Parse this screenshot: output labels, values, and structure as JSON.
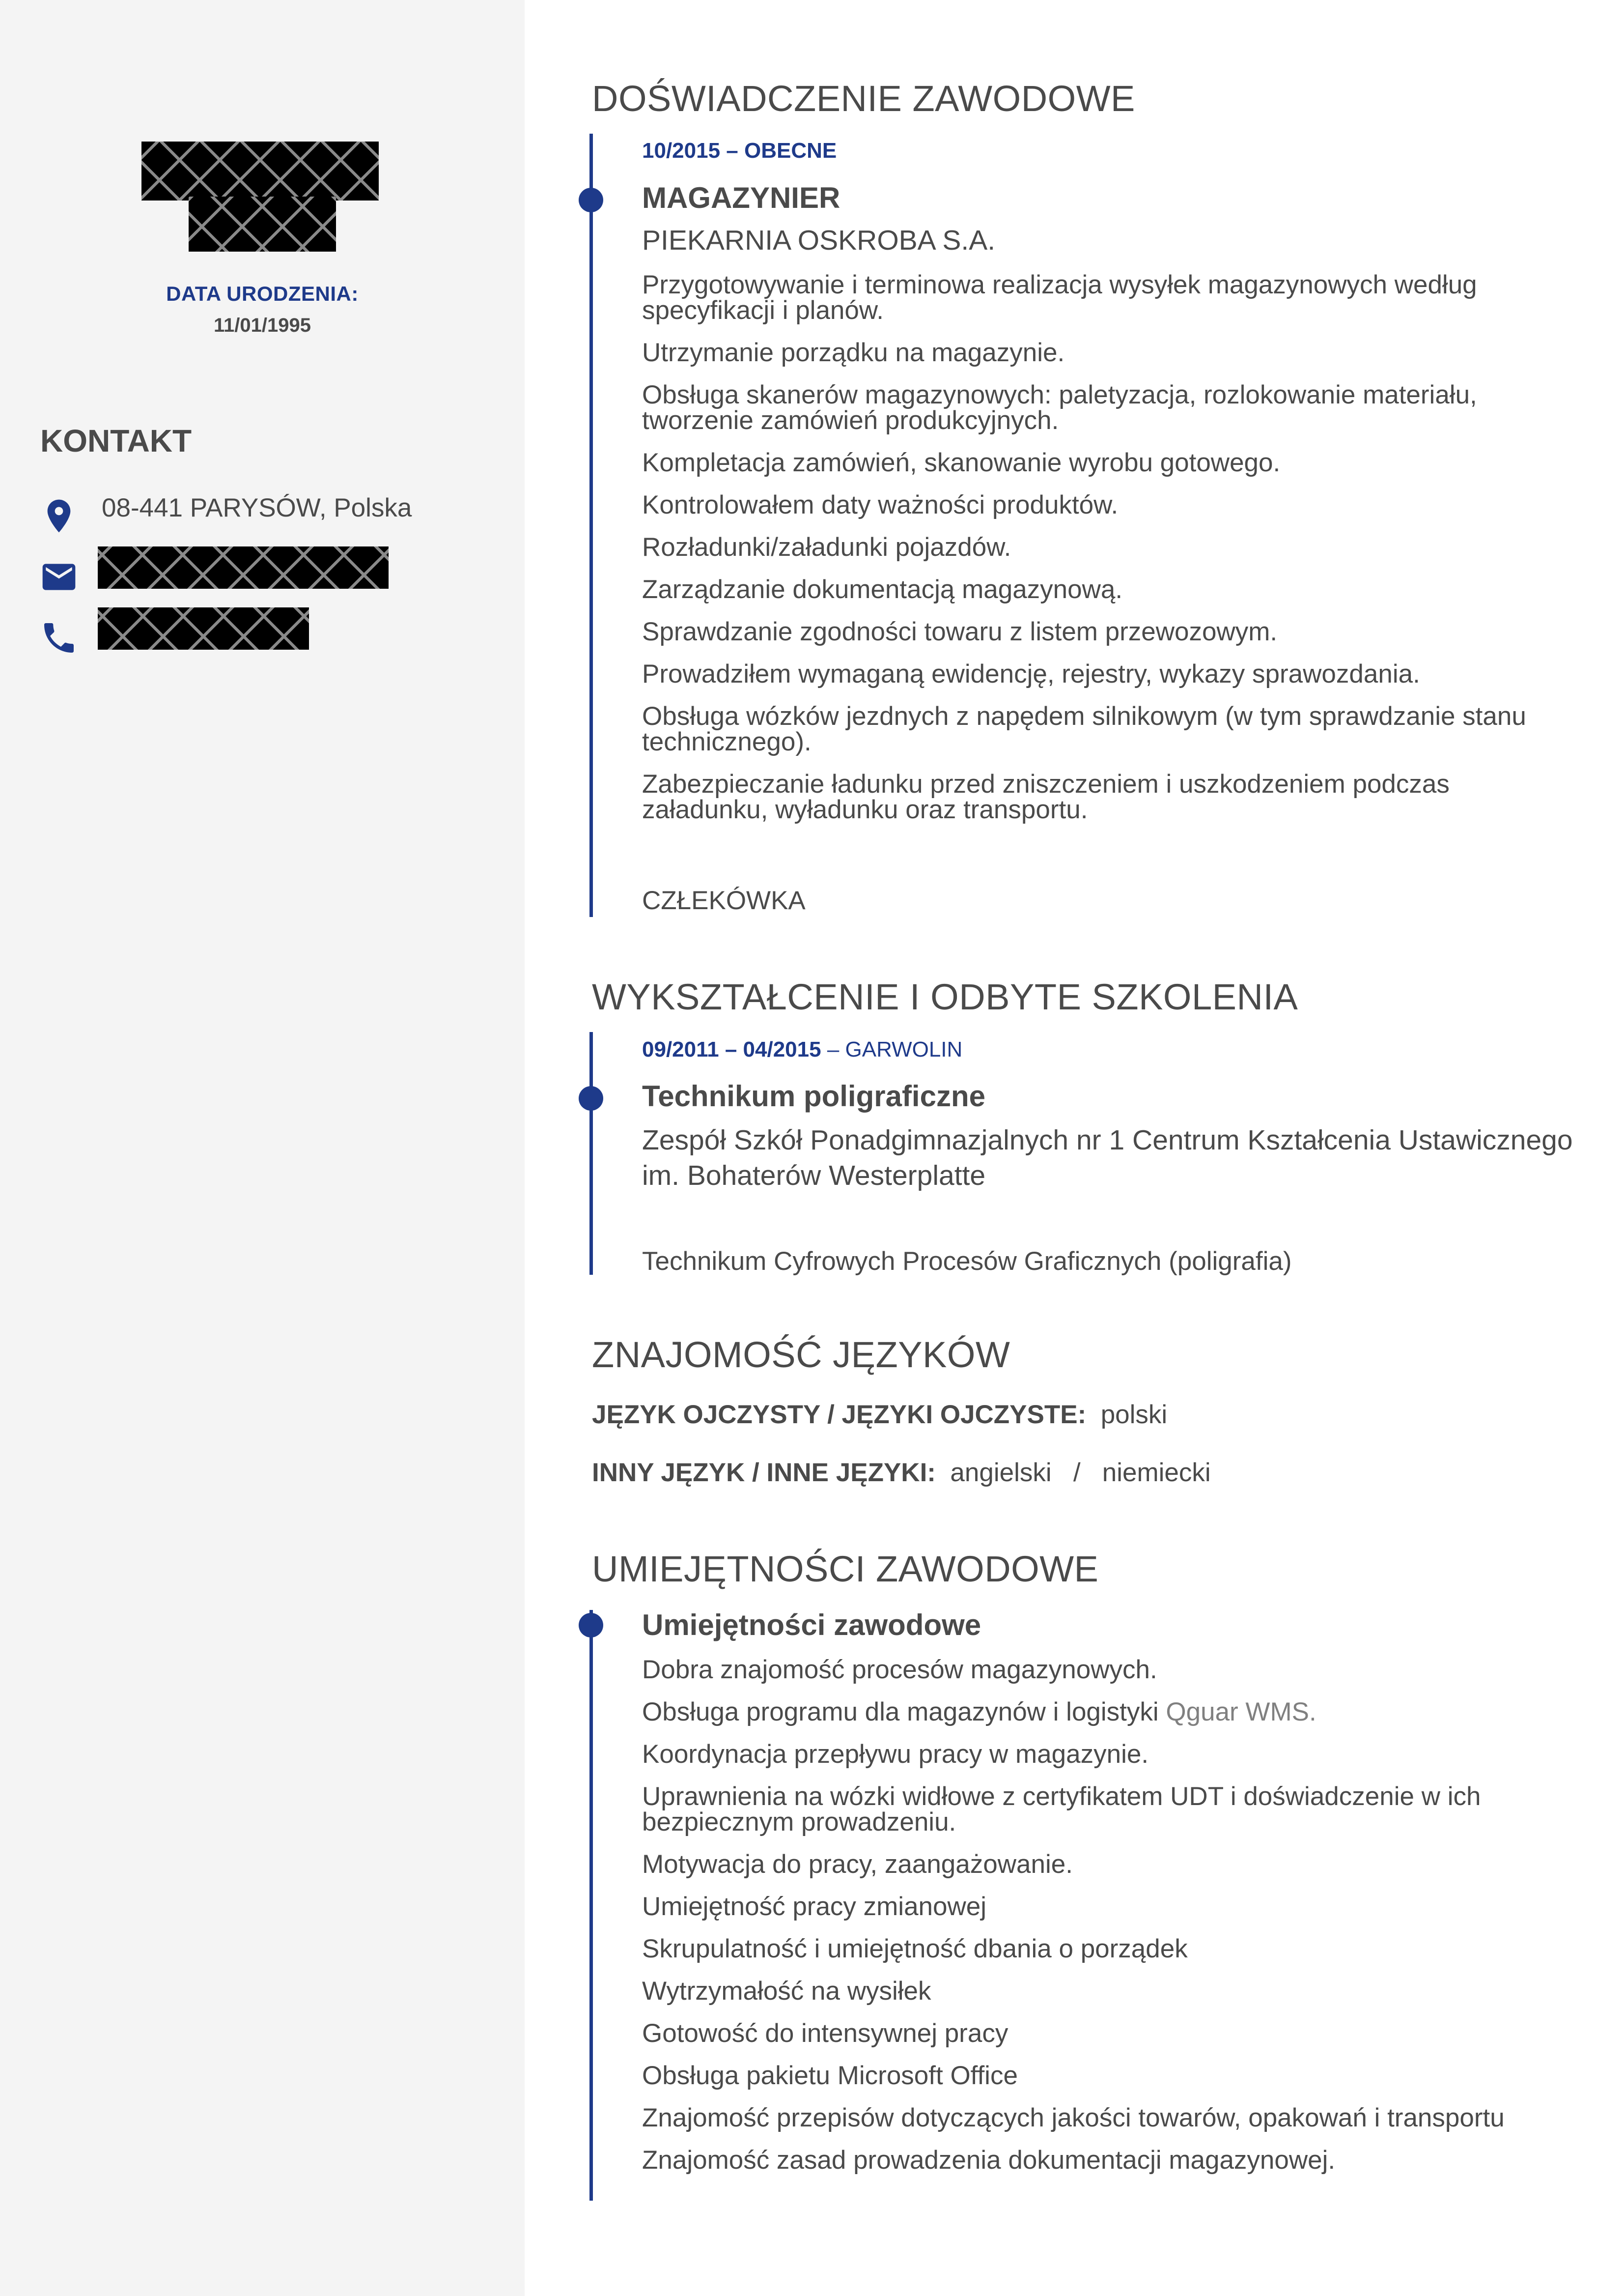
{
  "sidebar": {
    "dob_label": "DATA URODZENIA:",
    "dob_value": "11/01/1995",
    "contact_title": "KONTAKT",
    "address": "08-441 PARYSÓW, Polska",
    "icons": [
      "location-icon",
      "email-icon",
      "phone-icon"
    ]
  },
  "experience": {
    "title": "DOŚWIADCZENIE ZAWODOWE",
    "date": "10/2015 – OBECNE",
    "position": "MAGAZYNIER",
    "employer": "PIEKARNIA OSKROBA S.A.",
    "duties": [
      " Przygotowywanie i terminowa realizacja wysyłek magazynowych według specyfikacji i planów.",
      "Utrzymanie porządku na magazynie.",
      "Obsługa skanerów magazynowych: paletyzacja, rozlokowanie materiału, tworzenie zamówień produkcyjnych.",
      "Kompletacja zamówień, skanowanie wyrobu gotowego.",
      "Kontrolowałem daty ważności produktów.",
      "Rozładunki/załadunki pojazdów.",
      "Zarządzanie dokumentacją magazynową.",
      "Sprawdzanie zgodności towaru z listem przewozowym.",
      "Prowadziłem wymaganą ewidencję, rejestry, wykazy sprawozdania.",
      "Obsługa wózków jezdnych z napędem silnikowym (w tym sprawdzanie stanu technicznego).",
      "Zabezpieczanie ładunku przed zniszczeniem i uszkodzeniem podczas załadunku, wyładunku oraz transportu."
    ],
    "location": "CZŁEKÓWKA"
  },
  "education": {
    "title": "WYKSZTAŁCENIE I ODBYTE SZKOLENIA",
    "date": "09/2011 – 04/2015",
    "place": " – GARWOLIN",
    "degree": "Technikum poligraficzne",
    "school": "Zespół Szkół Ponadgimnazjalnych nr 1 Centrum Kształcenia Ustawicznego im. Bohaterów Westerplatte",
    "field": "Technikum Cyfrowych Procesów Graficznych (poligrafia)"
  },
  "languages": {
    "title": "ZNAJOMOŚĆ JĘZYKÓW",
    "native_label": "JĘZYK OJCZYSTY / JĘZYKI OJCZYSTE:",
    "native_value": "polski",
    "other_label": "INNY JĘZYK / INNE JĘZYKI:",
    "other_values": [
      "angielski",
      "niemiecki"
    ],
    "separator": "/"
  },
  "skills": {
    "title": "UMIEJĘTNOŚCI ZAWODOWE",
    "subtitle": "Umiejętności zawodowe",
    "items": [
      "Dobra znajomość procesów magazynowych.",
      "Obsługa programu dla magazynów i logistyki ",
      "Koordynacja przepływu pracy w magazynie.",
      "Uprawnienia na wózki widłowe z certyfikatem UDT i doświadczenie w ich bezpiecznym prowadzeniu.",
      "Motywacja do pracy, zaangażowanie.",
      "Umiejętność pracy zmianowej",
      "Skrupulatność i umiejętność dbania o porządek",
      "Wytrzymałość na wysiłek",
      "Gotowość do intensywnej pracy",
      "Obsługa pakietu Microsoft Office",
      "Znajomość przepisów dotyczących jakości towarów, opakowań i transportu",
      "Znajomość zasad prowadzenia dokumentacji magazynowej."
    ],
    "highlight": "Qguar WMS."
  },
  "colors": {
    "accent": "#1e3a8a",
    "text": "#4a4a4a",
    "sidebar_bg": "#f4f4f4"
  }
}
